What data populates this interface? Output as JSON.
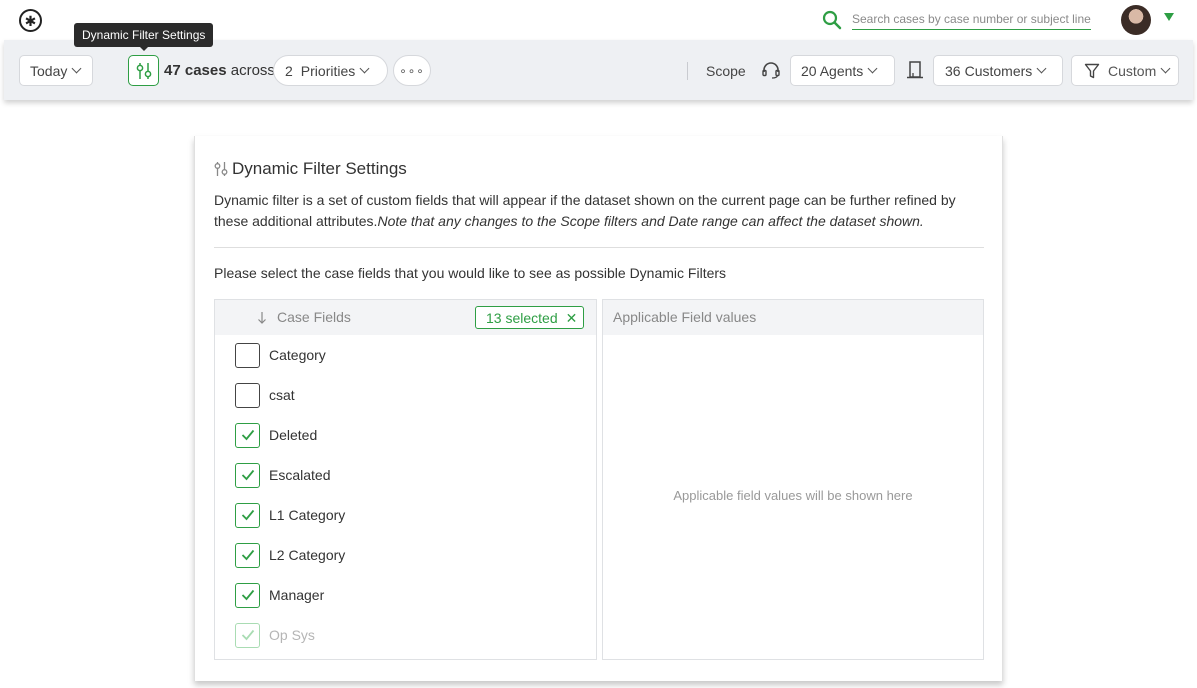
{
  "header": {
    "search_placeholder": "Search cases by case number or subject line",
    "tooltip": "Dynamic Filter Settings"
  },
  "filterbar": {
    "date": "Today",
    "cases_count": "47 cases",
    "cases_suffix": "across",
    "priorities_count": "2",
    "priorities_label": "Priorities",
    "more": "∘∘∘",
    "scope_label": "Scope",
    "agents": "20 Agents",
    "customers_count": "36",
    "customers_label": "Customers",
    "custom": "Custom"
  },
  "panel": {
    "title": "Dynamic Filter Settings",
    "description": "Dynamic filter is a set of custom fields that will appear if the dataset shown on the current page can be further refined by these additional attributes.",
    "note": "Note that any changes to the Scope filters and Date range can affect the dataset shown.",
    "instruction": "Please select the case fields that you would like to see as possible Dynamic Filters",
    "left_header": "Case Fields",
    "selected_badge": "13 selected",
    "right_header": "Applicable Field values",
    "right_placeholder": "Applicable field values will be shown here",
    "fields": [
      {
        "label": "Category",
        "checked": false,
        "faded": false
      },
      {
        "label": "csat",
        "checked": false,
        "faded": false
      },
      {
        "label": "Deleted",
        "checked": true,
        "faded": false
      },
      {
        "label": "Escalated",
        "checked": true,
        "faded": false
      },
      {
        "label": "L1 Category",
        "checked": true,
        "faded": false
      },
      {
        "label": "L2 Category",
        "checked": true,
        "faded": false
      },
      {
        "label": "Manager",
        "checked": true,
        "faded": false
      },
      {
        "label": "Op Sys",
        "checked": true,
        "faded": true
      }
    ]
  },
  "colors": {
    "accent": "#2e9e44",
    "filterbar_bg": "#eef0f3",
    "tooltip_bg": "#2b2b2b"
  },
  "icons": [
    "logo-icon",
    "search-icon",
    "avatar",
    "chevron-down-icon",
    "tune-icon",
    "more-icon",
    "headset-icon",
    "building-icon",
    "funnel-icon",
    "sort-down-icon",
    "close-icon",
    "checkmark-icon"
  ]
}
